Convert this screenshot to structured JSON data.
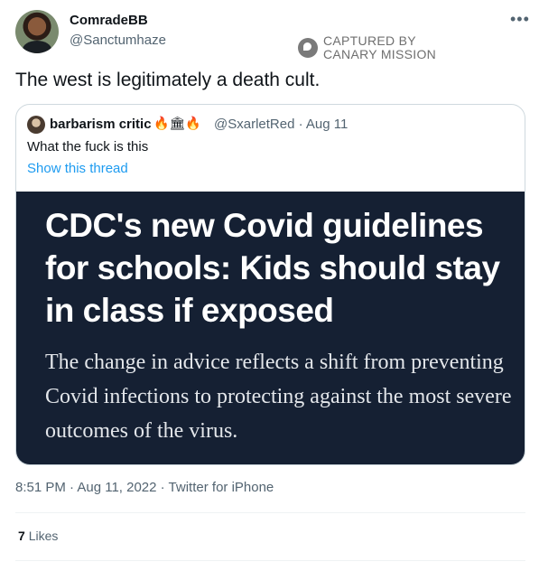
{
  "author": {
    "display_name": "ComradeBB",
    "handle": "@Sanctumhaze"
  },
  "watermark": {
    "line1": "CAPTURED BY",
    "line2": "CANARY MISSION"
  },
  "tweet": {
    "text": "The west is legitimately a death cult.",
    "timestamp": "8:51 PM · Aug 11, 2022 · Twitter for iPhone",
    "like_count": "7",
    "like_label": "Likes"
  },
  "quote": {
    "display_name": "barbarism critic",
    "badges": "🔥🏛🔥",
    "handle_date": "@SxarletRed · Aug 11",
    "text": "What the fuck is this",
    "show_thread": "Show this thread",
    "image": {
      "headline": "CDC's new Covid guidelines for schools: Kids should stay in class if exposed",
      "subhead": "The change in advice reflects a shift from preventing Covid infections to protecting against the most severe outcomes of the virus."
    }
  },
  "icons": {
    "more": "more-options-icon",
    "watermark": "canary-logo-icon"
  },
  "colors": {
    "link": "#1d9bf0",
    "secondary_text": "#536471",
    "image_bg": "#152033"
  }
}
